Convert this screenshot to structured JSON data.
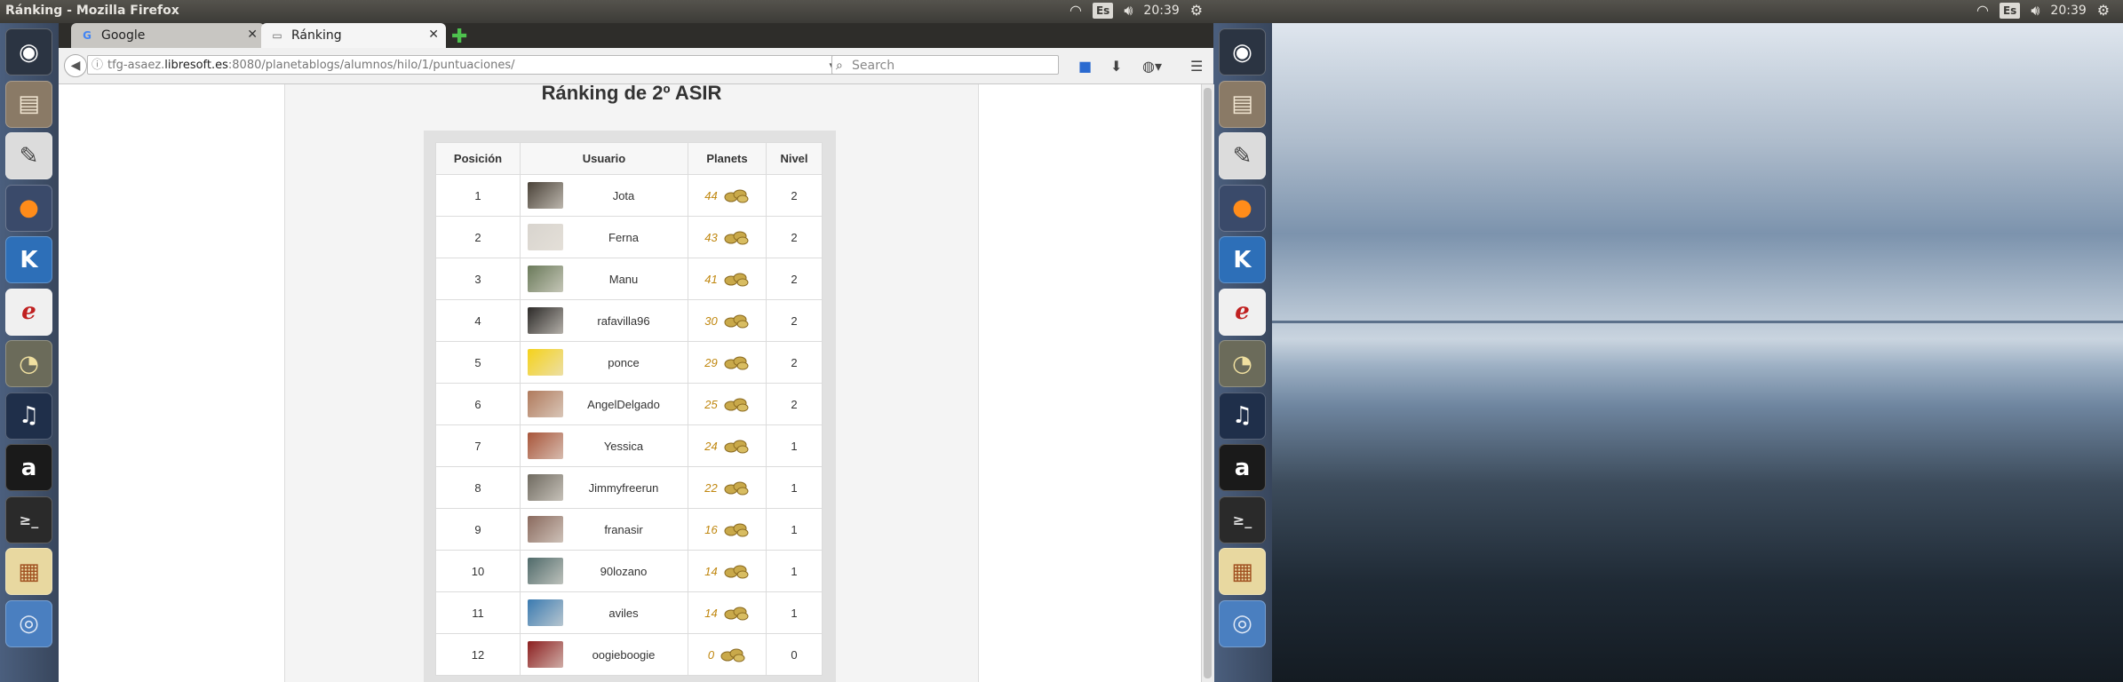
{
  "top_panel": {
    "window_title": "Ránking - Mozilla Firefox",
    "keyboard_layout": "Es",
    "time": "20:39"
  },
  "launcher": {
    "items": [
      "ubuntu-dash-icon",
      "files-icon",
      "text-editor-icon",
      "firefox-icon",
      "kde-connect-icon",
      "evince-icon",
      "gimp-icon",
      "audacity-icon",
      "amazon-icon",
      "terminal-icon",
      "impress-icon",
      "chromium-icon"
    ]
  },
  "browser": {
    "tabs": [
      {
        "label": "Google",
        "icon": "google-icon"
      },
      {
        "label": "Ránking",
        "icon": "page-icon"
      }
    ],
    "url_prefix": "tfg-asaez.",
    "url_host": "libresoft.es",
    "url_rest": ":8080/planetablogs/alumnos/hilo/1/puntuaciones/",
    "search_placeholder": "Search"
  },
  "page": {
    "heading": "Ránking de 2º ASIR",
    "columns": [
      "Posición",
      "Usuario",
      "Planets",
      "Nivel"
    ],
    "rows": [
      {
        "pos": "1",
        "user": "Jota",
        "planets": "44",
        "nivel": "2",
        "avatar": "#4a4238"
      },
      {
        "pos": "2",
        "user": "Ferna",
        "planets": "43",
        "nivel": "2",
        "avatar": "#d8d4ce"
      },
      {
        "pos": "3",
        "user": "Manu",
        "planets": "41",
        "nivel": "2",
        "avatar": "#6a7a5a"
      },
      {
        "pos": "4",
        "user": "rafavilla96",
        "planets": "30",
        "nivel": "2",
        "avatar": "#2c2a28"
      },
      {
        "pos": "5",
        "user": "ponce",
        "planets": "29",
        "nivel": "2",
        "avatar": "#f5d21a"
      },
      {
        "pos": "6",
        "user": "AngelDelgado",
        "planets": "25",
        "nivel": "2",
        "avatar": "#b07a5c"
      },
      {
        "pos": "7",
        "user": "Yessica",
        "planets": "24",
        "nivel": "1",
        "avatar": "#a8553a"
      },
      {
        "pos": "8",
        "user": "Jimmyfreerun",
        "planets": "22",
        "nivel": "1",
        "avatar": "#6f6a60"
      },
      {
        "pos": "9",
        "user": "franasir",
        "planets": "16",
        "nivel": "1",
        "avatar": "#8a6a5e"
      },
      {
        "pos": "10",
        "user": "90lozano",
        "planets": "14",
        "nivel": "1",
        "avatar": "#4f6a6a"
      },
      {
        "pos": "11",
        "user": "aviles",
        "planets": "14",
        "nivel": "1",
        "avatar": "#3a7ab0"
      },
      {
        "pos": "12",
        "user": "oogieboogie",
        "planets": "0",
        "nivel": "0",
        "avatar": "#8c1f1f"
      }
    ]
  },
  "colors": {
    "planets_value": "#c0870f",
    "coin": "#c9a94a"
  }
}
